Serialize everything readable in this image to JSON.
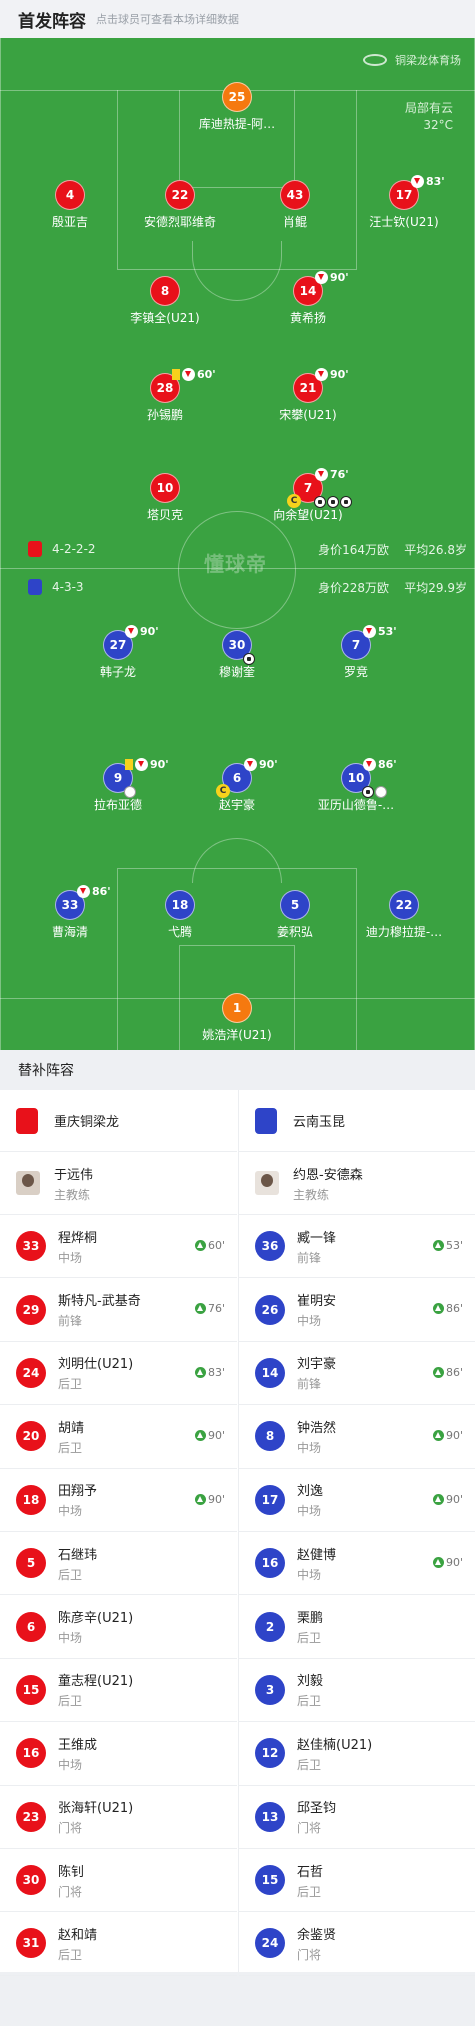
{
  "header": {
    "title": "首发阵容",
    "subtitle": "点击球员可查看本场详细数据"
  },
  "pitch": {
    "venue": "铜梁龙体育场",
    "weather": "局部有云",
    "temperature": "32°C",
    "watermark": "懂球帝",
    "home": {
      "formation": "4-2-2-2",
      "value": "身价164万欧",
      "avg_age": "平均26.8岁",
      "color": "#e8111a"
    },
    "away": {
      "formation": "4-3-3",
      "value": "身价228万欧",
      "avg_age": "平均29.9岁",
      "color": "#2e44c8"
    },
    "home_players": [
      {
        "num": "25",
        "name": "库迪热提-阿…",
        "gk": true
      },
      {
        "num": "4",
        "name": "殷亚吉"
      },
      {
        "num": "22",
        "name": "安德烈耶维奇"
      },
      {
        "num": "43",
        "name": "肖鲲"
      },
      {
        "num": "17",
        "name": "汪士钦(U21)",
        "sub": "83'"
      },
      {
        "num": "8",
        "name": "李镇全(U21)"
      },
      {
        "num": "14",
        "name": "黄希扬",
        "sub": "90'"
      },
      {
        "num": "28",
        "name": "孙锡鹏",
        "sub": "60'",
        "yellow": true
      },
      {
        "num": "21",
        "name": "宋攀(U21)",
        "sub": "90'"
      },
      {
        "num": "10",
        "name": "塔贝克"
      },
      {
        "num": "7",
        "name": "向余望(U21)",
        "sub": "76'",
        "captain": "C",
        "goals": 3
      }
    ],
    "away_players": [
      {
        "num": "27",
        "name": "韩子龙",
        "sub": "90'"
      },
      {
        "num": "30",
        "name": "穆谢奎",
        "goals": 1
      },
      {
        "num": "7",
        "name": "罗竞",
        "sub": "53'"
      },
      {
        "num": "9",
        "name": "拉布亚德",
        "sub": "90'",
        "yellow": true,
        "assist": true
      },
      {
        "num": "6",
        "name": "赵宇豪",
        "sub": "90'",
        "captain": "C"
      },
      {
        "num": "10",
        "name": "亚历山德鲁-…",
        "sub": "86'",
        "goals": 1,
        "assist": true
      },
      {
        "num": "33",
        "name": "曹海清",
        "sub": "86'"
      },
      {
        "num": "18",
        "name": "弋腾"
      },
      {
        "num": "5",
        "name": "姜积弘"
      },
      {
        "num": "22",
        "name": "迪力穆拉提-…"
      },
      {
        "num": "1",
        "name": "姚浩洋(U21)",
        "gk": true
      }
    ]
  },
  "subs": {
    "title": "替补阵容",
    "home": {
      "team": "重庆铜梁龙",
      "coach": {
        "name": "于远伟",
        "role": "主教练"
      },
      "players": [
        {
          "num": "33",
          "name": "程烨桐",
          "pos": "中场",
          "in": "60'"
        },
        {
          "num": "29",
          "name": "斯特凡-武基奇",
          "pos": "前锋",
          "in": "76'"
        },
        {
          "num": "24",
          "name": "刘明仕(U21)",
          "pos": "后卫",
          "in": "83'"
        },
        {
          "num": "20",
          "name": "胡靖",
          "pos": "后卫",
          "in": "90'"
        },
        {
          "num": "18",
          "name": "田翔予",
          "pos": "中场",
          "in": "90'"
        },
        {
          "num": "5",
          "name": "石继玮",
          "pos": "后卫"
        },
        {
          "num": "6",
          "name": "陈彦辛(U21)",
          "pos": "中场"
        },
        {
          "num": "15",
          "name": "童志程(U21)",
          "pos": "后卫"
        },
        {
          "num": "16",
          "name": "王维成",
          "pos": "中场"
        },
        {
          "num": "23",
          "name": "张海轩(U21)",
          "pos": "门将"
        },
        {
          "num": "30",
          "name": "陈钊",
          "pos": "门将"
        },
        {
          "num": "31",
          "name": "赵和靖",
          "pos": "后卫"
        }
      ]
    },
    "away": {
      "team": "云南玉昆",
      "coach": {
        "name": "约恩-安德森",
        "role": "主教练"
      },
      "players": [
        {
          "num": "36",
          "name": "臧一锋",
          "pos": "前锋",
          "in": "53'"
        },
        {
          "num": "26",
          "name": "崔明安",
          "pos": "中场",
          "in": "86'"
        },
        {
          "num": "14",
          "name": "刘宇豪",
          "pos": "前锋",
          "in": "86'"
        },
        {
          "num": "8",
          "name": "钟浩然",
          "pos": "中场",
          "in": "90'"
        },
        {
          "num": "17",
          "name": "刘逸",
          "pos": "中场",
          "in": "90'"
        },
        {
          "num": "16",
          "name": "赵健博",
          "pos": "中场",
          "in": "90'"
        },
        {
          "num": "2",
          "name": "栗鹏",
          "pos": "后卫"
        },
        {
          "num": "3",
          "name": "刘毅",
          "pos": "后卫"
        },
        {
          "num": "12",
          "name": "赵佳楠(U21)",
          "pos": "后卫"
        },
        {
          "num": "13",
          "name": "邱圣钧",
          "pos": "门将"
        },
        {
          "num": "15",
          "name": "石哲",
          "pos": "后卫"
        },
        {
          "num": "24",
          "name": "余鉴贤",
          "pos": "门将"
        }
      ]
    }
  }
}
